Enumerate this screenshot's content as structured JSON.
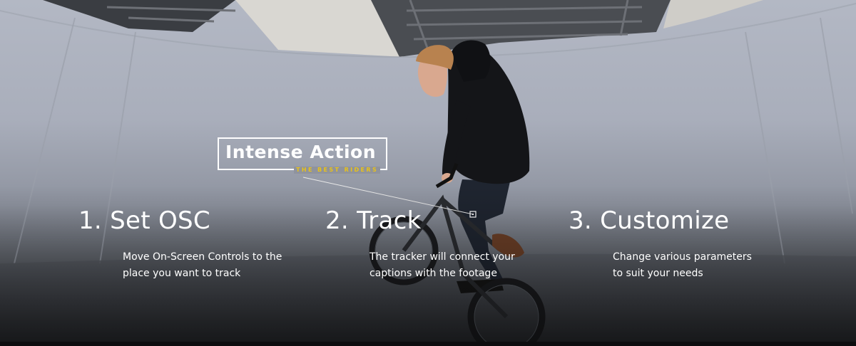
{
  "caption": {
    "title": "Intense Action",
    "subtitle": "THE BEST RIDERS"
  },
  "steps": [
    {
      "heading": "1. Set OSC",
      "lines": [
        "Move On-Screen Controls to the",
        "place you want to track"
      ]
    },
    {
      "heading": "2. Track",
      "lines": [
        "The tracker will connect your",
        "captions with the footage"
      ]
    },
    {
      "heading": "3. Customize",
      "lines": [
        "Change various parameters",
        "to suit your needs"
      ]
    }
  ],
  "colors": {
    "caption_accent": "#e8c21a",
    "text": "#ffffff",
    "wall": "#aeb3bf"
  }
}
